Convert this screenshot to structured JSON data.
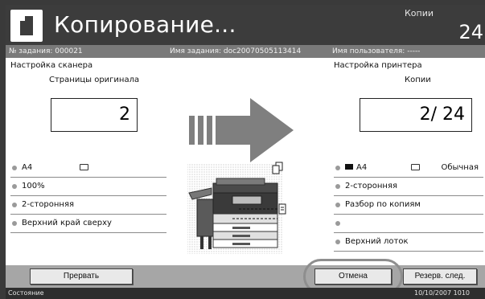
{
  "header": {
    "title": "Копирование...",
    "copies_label": "Копии",
    "copies_value": "24"
  },
  "infobar": {
    "job_no": "№ задания: 000021",
    "job_name": "Имя задания: doc20070505113414",
    "user_name": "Имя пользователя: -----"
  },
  "scanner": {
    "title": "Настройка сканера",
    "pages_label": "Страницы оригинала",
    "pages_value": "2",
    "items": [
      "A4",
      "100%",
      "2-сторонняя",
      "Верхний край сверху"
    ]
  },
  "printer": {
    "title": "Настройка принтера",
    "copies_label": "Копии",
    "copies_value": "2/  24",
    "paper_type": "Обычная",
    "items": [
      "A4",
      "2-сторонняя",
      "Разбор по копиям",
      "",
      "Верхний лоток"
    ]
  },
  "buttons": {
    "stop": "Прервать",
    "cancel": "Отмена",
    "reserve_next": "Резерв. след."
  },
  "status": {
    "label": "Состояние",
    "datetime": "10/10/2007  1010"
  },
  "icons": {
    "header": "copy-document-icon",
    "arrow": "right-arrow-icon",
    "device": "copier-machine-icon"
  }
}
